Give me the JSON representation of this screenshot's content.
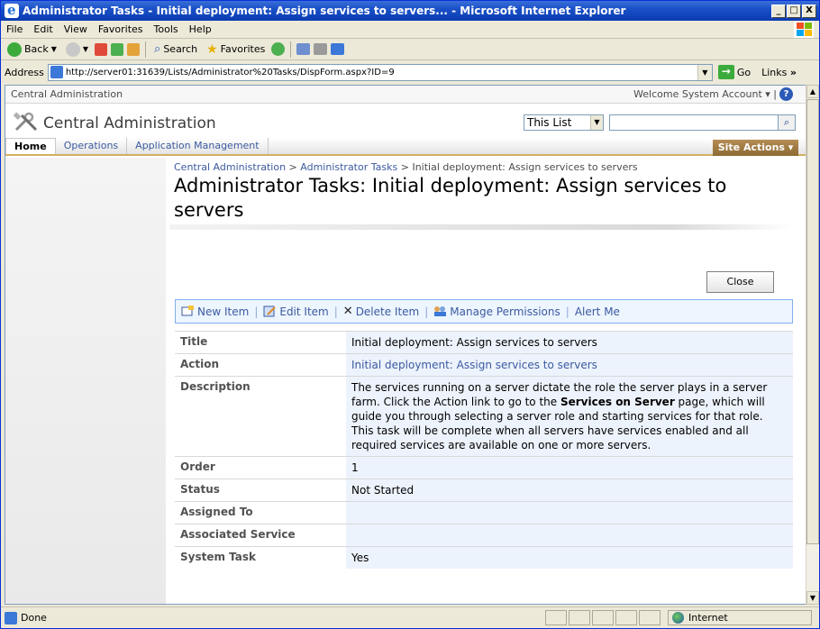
{
  "window": {
    "title": "Administrator Tasks - Initial deployment: Assign services to servers... - Microsoft Internet Explorer",
    "min": "_",
    "max": "□",
    "close": "X"
  },
  "menu": [
    "File",
    "Edit",
    "View",
    "Favorites",
    "Tools",
    "Help"
  ],
  "toolbar": {
    "back": "Back",
    "search": "Search",
    "favorites": "Favorites"
  },
  "address": {
    "label": "Address",
    "url": "http://server01:31639/Lists/Administrator%20Tasks/DispForm.aspx?ID=9",
    "go": "Go",
    "links": "Links"
  },
  "sp": {
    "top_label": "Central Administration",
    "welcome": "Welcome System Account ▾  |",
    "site_title": "Central Administration",
    "search_scope": "This List",
    "nav_tabs": [
      "Home",
      "Operations",
      "Application Management"
    ],
    "site_actions": "Site Actions ▾"
  },
  "breadcrumb": {
    "parts": [
      "Central Administration",
      "Administrator Tasks"
    ],
    "separator": " > ",
    "current": "Initial deployment: Assign services to servers"
  },
  "page_title": "Administrator Tasks: Initial deployment: Assign services to servers",
  "close_label": "Close",
  "item_toolbar": {
    "new_item": "New Item",
    "edit_item": "Edit Item",
    "delete_item": "Delete Item",
    "manage_permissions": "Manage Permissions",
    "alert_me": "Alert Me",
    "sep": "|"
  },
  "fields": {
    "title": {
      "label": "Title",
      "value": "Initial deployment: Assign services to servers"
    },
    "action": {
      "label": "Action",
      "value": "Initial deployment: Assign services to servers"
    },
    "description": {
      "label": "Description",
      "p1_before": "The services running on a server dictate the role the server plays in a server farm. Click the Action link to go to the ",
      "p1_bold": "Services on Server",
      "p1_after": " page, which will guide you through selecting a server role and starting services for that role.",
      "p2": "This task will be complete when all servers have services enabled and all required services are available on one or more servers."
    },
    "order": {
      "label": "Order",
      "value": "1"
    },
    "status": {
      "label": "Status",
      "value": "Not Started"
    },
    "assigned_to": {
      "label": "Assigned To",
      "value": ""
    },
    "associated_service": {
      "label": "Associated Service",
      "value": ""
    },
    "system_task": {
      "label": "System Task",
      "value": "Yes"
    }
  },
  "status": {
    "text": "Done",
    "zone": "Internet"
  }
}
